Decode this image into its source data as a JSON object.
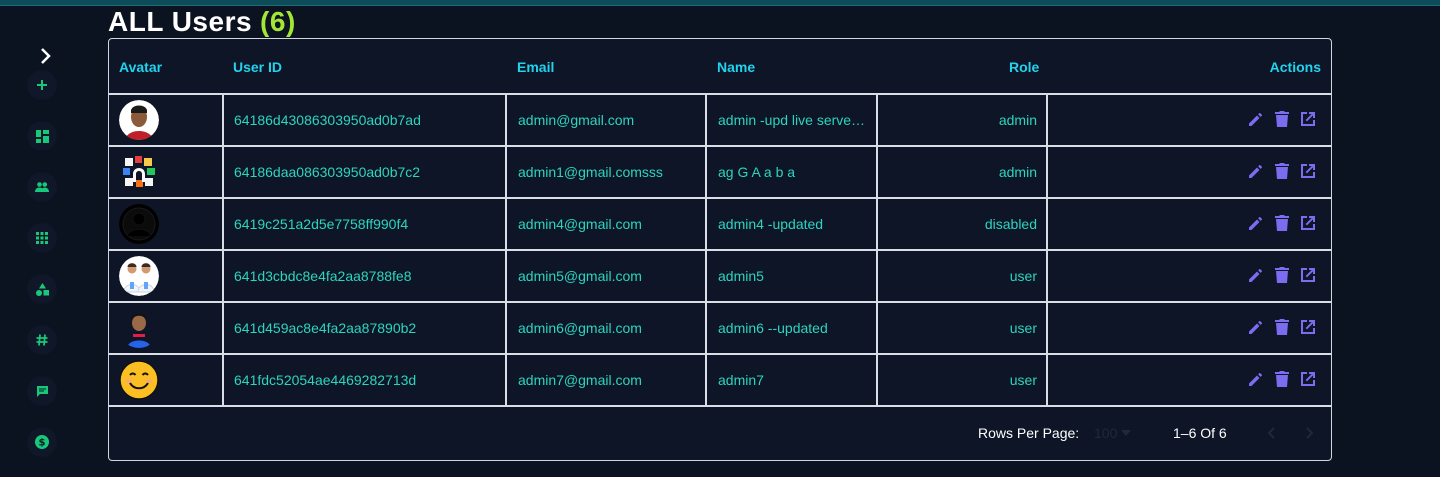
{
  "page": {
    "title": "ALL Users",
    "count": "(6)"
  },
  "table": {
    "headers": {
      "avatar": "Avatar",
      "user_id": "User ID",
      "email": "Email",
      "name": "Name",
      "role": "Role",
      "actions": "Actions"
    },
    "rows": [
      {
        "user_id": "64186d43086303950ad0b7ad",
        "email": "admin@gmail.com",
        "name": "admin -upd live serve…",
        "role": "admin",
        "avatar": "photo-man-red"
      },
      {
        "user_id": "64186daa086303950ad0b7c2",
        "email": "admin1@gmail.comsss",
        "name": "ag G A a b a",
        "role": "admin",
        "avatar": "collage"
      },
      {
        "user_id": "6419c251a2d5e7758ff990f4",
        "email": "admin4@gmail.com",
        "name": "admin4 -updated",
        "role": "disabled",
        "avatar": "default-silhouette"
      },
      {
        "user_id": "641d3cbdc8e4fa2aa8788fe8",
        "email": "admin5@gmail.com",
        "name": "admin5",
        "role": "user",
        "avatar": "doctors"
      },
      {
        "user_id": "641d459ac8e4fa2aa87890b2",
        "email": "admin6@gmail.com",
        "name": "admin6 --updated",
        "role": "user",
        "avatar": "photo-boy"
      },
      {
        "user_id": "641fdc52054ae4469282713d",
        "email": "admin7@gmail.com",
        "name": "admin7",
        "role": "user",
        "avatar": "smiley"
      }
    ]
  },
  "pagination": {
    "rows_per_page_label": "Rows Per Page:",
    "rows_per_page_value": "100",
    "range": "1–6 Of 6"
  },
  "sidebar": {
    "icons": [
      "chevron-right-icon",
      "plus-icon",
      "dashboard-icon",
      "users-icon",
      "apps-icon",
      "shapes-icon",
      "hashtag-icon",
      "chat-icon",
      "dollar-icon"
    ]
  },
  "colors": {
    "accent": "#22d3ee",
    "text": "#2dd4bf",
    "action": "#7c6cf0",
    "count": "#a3e635"
  }
}
